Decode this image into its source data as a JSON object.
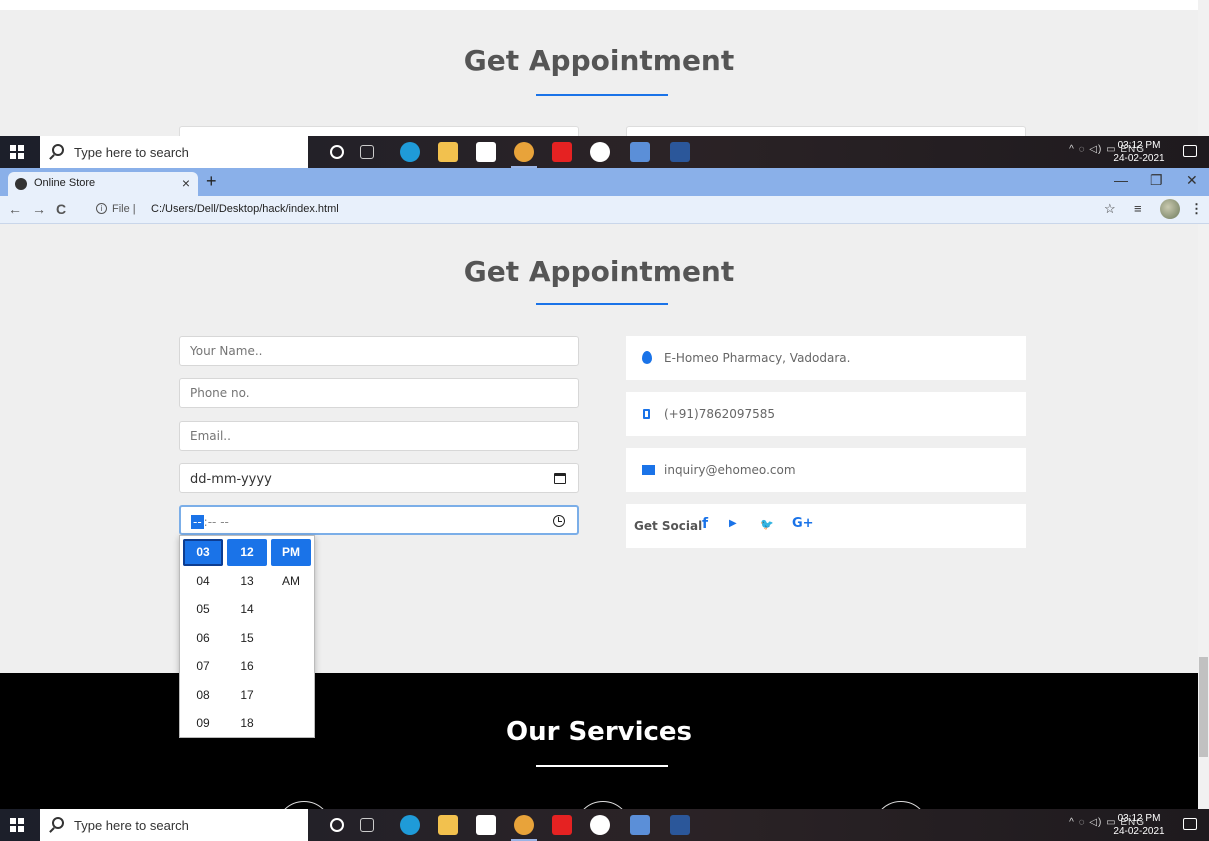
{
  "section": {
    "title": "Get Appointment"
  },
  "taskbar": {
    "search_placeholder": "Type here to search",
    "tray_text": "^  ◌  ◁)  ▭  ENG",
    "time": "03:12 PM",
    "date": "24-02-2021"
  },
  "browser": {
    "tab_title": "Online Store",
    "tab_close": "×",
    "new_tab": "+",
    "url_prefix": "File  |",
    "url": "C:/Users/Dell/Desktop/hack/index.html",
    "minimize": "—",
    "restore": "❐",
    "close": "✕"
  },
  "form": {
    "name_placeholder": "Your Name..",
    "phone_placeholder": "Phone no.",
    "email_placeholder": "Email..",
    "date_value": "dd-mm-yyyy",
    "time_selected_part": "--",
    "time_rest": ":-- --"
  },
  "time_picker": {
    "hours": [
      "03",
      "04",
      "05",
      "06",
      "07",
      "08",
      "09"
    ],
    "minutes": [
      "12",
      "13",
      "14",
      "15",
      "16",
      "17",
      "18"
    ],
    "ampm": [
      "PM",
      "AM"
    ]
  },
  "contact": {
    "address": "E-Homeo Pharmacy, Vadodara.",
    "phone": "(+91)7862097585",
    "email": "inquiry@ehomeo.com",
    "social_label": "Get Social",
    "social_icons": {
      "facebook": "f",
      "youtube": "▶",
      "twitter": "🐦",
      "google_plus": "G+"
    }
  },
  "services": {
    "title": "Our Services"
  },
  "colors": {
    "accent": "#1a73e8",
    "page_bg": "#efefef",
    "footer_bg": "#000000"
  }
}
